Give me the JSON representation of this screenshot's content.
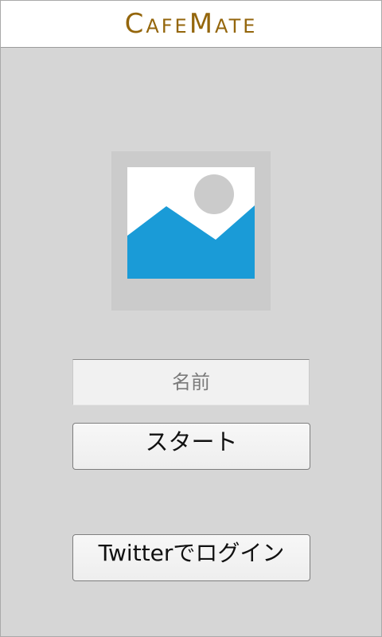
{
  "header": {
    "title": "CafeMate"
  },
  "colors": {
    "brand": "#94660c",
    "background": "#d6d6d6",
    "placeholder_sky": "#ffffff",
    "placeholder_mountain": "#1a9bd7",
    "placeholder_sun": "#cbcbcb"
  },
  "avatar": {
    "icon": "image-placeholder-icon"
  },
  "form": {
    "name_placeholder": "名前",
    "name_value": ""
  },
  "buttons": {
    "start_label": "スタート",
    "twitter_login_label": "Twitterでログイン"
  }
}
